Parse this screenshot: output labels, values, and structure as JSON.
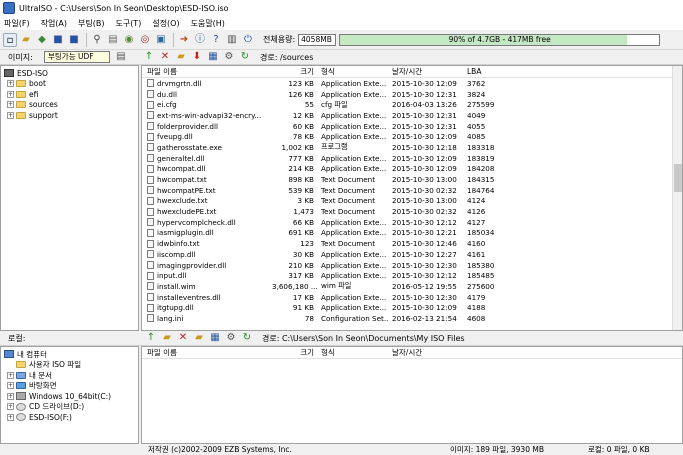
{
  "window": {
    "title": "UltraISO - C:\\Users\\Son In Seon\\Desktop\\ESD-ISO.iso"
  },
  "menu": [
    "파일(F)",
    "작업(A)",
    "부팅(B)",
    "도구(T)",
    "설정(O)",
    "도움말(H)"
  ],
  "toolbar": {
    "capacity_label": "전체용량:",
    "capacity_value": "4058MB",
    "capacity_text": "90% of 4.7GB - 417MB free",
    "capacity_fraction": 0.9
  },
  "image_pane": {
    "label": "이미지:",
    "boot_type": "부팅가능 UDF",
    "path_label": "경로: /sources",
    "tree": [
      {
        "name": "ESD-ISO",
        "level": 0,
        "expander": "-"
      },
      {
        "name": "boot",
        "level": 1,
        "expander": "+"
      },
      {
        "name": "efi",
        "level": 1,
        "expander": "+"
      },
      {
        "name": "sources",
        "level": 1,
        "expander": "+"
      },
      {
        "name": "support",
        "level": 1,
        "expander": "+"
      }
    ],
    "columns": [
      "파일 이름",
      "크기",
      "형식",
      "날자/시간",
      "LBA"
    ],
    "files": [
      [
        "drvmgrtn.dll",
        "123 KB",
        "Application Exte...",
        "2015-10-30 12:09",
        "3762"
      ],
      [
        "du.dll",
        "126 KB",
        "Application Exte...",
        "2015-10-30 12:31",
        "3824"
      ],
      [
        "ei.cfg",
        "55",
        "cfg 파일",
        "2016-04-03 13:26",
        "275599"
      ],
      [
        "ext-ms-win-advapi32-encry...",
        "12 KB",
        "Application Exte...",
        "2015-10-30 12:31",
        "4049"
      ],
      [
        "folderprovider.dll",
        "60 KB",
        "Application Exte...",
        "2015-10-30 12:31",
        "4055"
      ],
      [
        "fveupg.dll",
        "78 KB",
        "Application Exte...",
        "2015-10-30 12:09",
        "4085"
      ],
      [
        "gatherosstate.exe",
        "1,002 KB",
        "프로그램",
        "2015-10-30 12:18",
        "183318"
      ],
      [
        "generaltel.dll",
        "777 KB",
        "Application Exte...",
        "2015-10-30 12:09",
        "183819"
      ],
      [
        "hwcompat.dll",
        "214 KB",
        "Application Exte...",
        "2015-10-30 12:09",
        "184208"
      ],
      [
        "hwcompat.txt",
        "898 KB",
        "Text Document",
        "2015-10-30 13:00",
        "184315"
      ],
      [
        "hwcompatPE.txt",
        "539 KB",
        "Text Document",
        "2015-10-30 02:32",
        "184764"
      ],
      [
        "hwexclude.txt",
        "3 KB",
        "Text Document",
        "2015-10-30 13:00",
        "4124"
      ],
      [
        "hwexcludePE.txt",
        "1,473",
        "Text Document",
        "2015-10-30 02:32",
        "4126"
      ],
      [
        "hypervcomplcheck.dll",
        "66 KB",
        "Application Exte...",
        "2015-10-30 12:12",
        "4127"
      ],
      [
        "iasmigplugin.dll",
        "691 KB",
        "Application Exte...",
        "2015-10-30 12:21",
        "185034"
      ],
      [
        "idwbinfo.txt",
        "123",
        "Text Document",
        "2015-10-30 12:46",
        "4160"
      ],
      [
        "iiscomp.dll",
        "30 KB",
        "Application Exte...",
        "2015-10-30 12:27",
        "4161"
      ],
      [
        "imagingprovider.dll",
        "210 KB",
        "Application Exte...",
        "2015-10-30 12:30",
        "185380"
      ],
      [
        "input.dll",
        "317 KB",
        "Application Exte...",
        "2015-10-30 12:12",
        "185485"
      ],
      [
        "install.wim",
        "3,606,180 ...",
        "wim 파일",
        "2016-05-12 19:55",
        "275600"
      ],
      [
        "installeventres.dll",
        "17 KB",
        "Application Exte...",
        "2015-10-30 12:30",
        "4179"
      ],
      [
        "itgtupg.dll",
        "91 KB",
        "Application Exte...",
        "2015-10-30 12:09",
        "4188"
      ],
      [
        "lang.ini",
        "78",
        "Configuration Set...",
        "2016-02-13 21:54",
        "4608"
      ]
    ]
  },
  "local_pane": {
    "label": "로컬:",
    "path_label": "경로: C:\\Users\\Son In Seon\\Documents\\My ISO Files",
    "tree": [
      {
        "name": "내 컴퓨터",
        "level": 0,
        "expander": "-"
      },
      {
        "name": "사용자 ISO 파일",
        "level": 1,
        "expander": ""
      },
      {
        "name": "내 문서",
        "level": 1,
        "expander": "+"
      },
      {
        "name": "바탕화면",
        "level": 1,
        "expander": "+"
      },
      {
        "name": "Windows 10_64bit(C:)",
        "level": 1,
        "expander": "+"
      },
      {
        "name": "CD 드라이브(D:)",
        "level": 1,
        "expander": "+"
      },
      {
        "name": "ESD-ISO(F:)",
        "level": 1,
        "expander": "+"
      }
    ],
    "columns": [
      "파일 이름",
      "크기",
      "형식",
      "날자/시간"
    ]
  },
  "status": {
    "copyright": "저작권 (c)2002-2009 EZB Systems, Inc.",
    "image_info": "이미지: 189 파일, 3930 MB",
    "local_info": "로컬: 0 파일, 0 KB"
  }
}
